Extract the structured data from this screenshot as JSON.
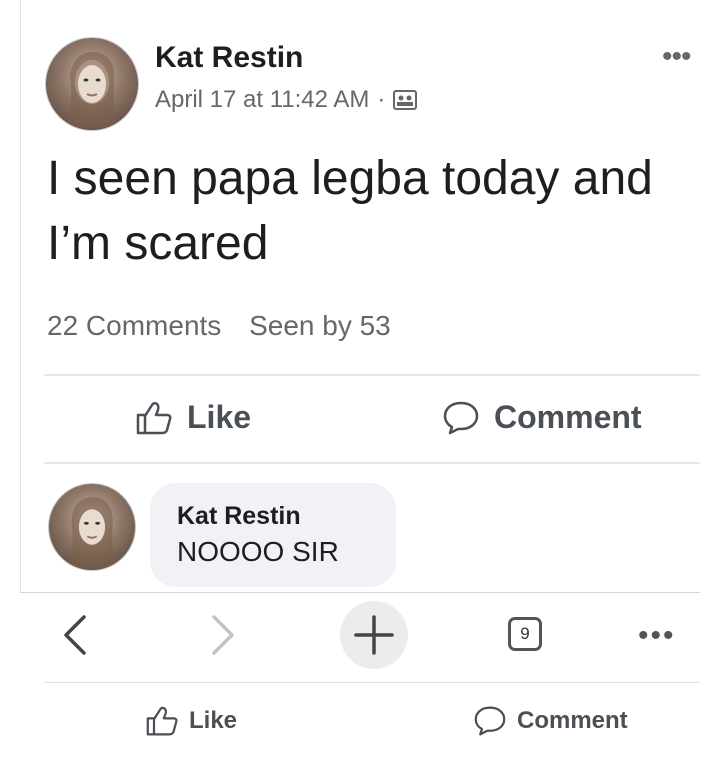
{
  "post": {
    "author": "Kat Restin",
    "timestamp": "April 17 at 11:42 AM",
    "separator": "·",
    "audience_icon": "audience-icon",
    "more": "•••",
    "text": "I seen papa legba today and I’m scared",
    "comments_count": "22 Comments",
    "seen_by": "Seen by 53"
  },
  "actions": {
    "like": "Like",
    "comment": "Comment"
  },
  "comment": {
    "author": "Kat Restin",
    "text": "NOOOO SIR"
  },
  "browser": {
    "tab_count": "9",
    "more": "•••"
  },
  "footer": {
    "like": "Like",
    "comment": "Comment"
  }
}
